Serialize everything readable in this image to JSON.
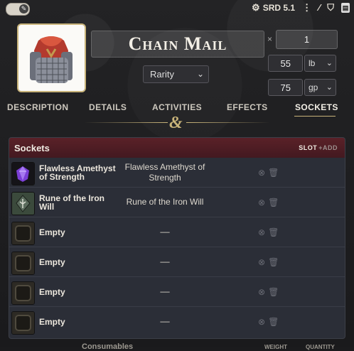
{
  "topbar": {
    "toggle_icon": "wrench-icon",
    "srd_label": "SRD 5.1",
    "icons": [
      "gear-icon",
      "kebab-menu-icon",
      "magic-wand-icon",
      "shield-icon",
      "document-icon"
    ]
  },
  "item": {
    "name": "Chain Mail",
    "rarity_placeholder": "Rarity",
    "quantity_symbol": "×",
    "quantity": "1",
    "weight_value": "55",
    "weight_unit": "lb",
    "price_value": "75",
    "price_unit": "gp"
  },
  "tabs": [
    {
      "label": "DESCRIPTION"
    },
    {
      "label": "DETAILS"
    },
    {
      "label": "ACTIVITIES"
    },
    {
      "label": "EFFECTS"
    },
    {
      "label": "SOCKETS"
    }
  ],
  "divider_glyph": "&",
  "sockets": {
    "title": "Sockets",
    "slot_label": "SLOT",
    "add_label": "+ADD",
    "rows": [
      {
        "name": "Flawless Amethyst of Strength",
        "description": "Flawless Amethyst of Strength",
        "icon": "amethyst-gem-icon"
      },
      {
        "name": "Rune of the Iron Will",
        "description": "Rune of the Iron Will",
        "icon": "rune-icon"
      },
      {
        "name": "Empty",
        "description": "––",
        "icon": "empty-slot-icon"
      },
      {
        "name": "Empty",
        "description": "––",
        "icon": "empty-slot-icon"
      },
      {
        "name": "Empty",
        "description": "––",
        "icon": "empty-slot-icon"
      },
      {
        "name": "Empty",
        "description": "––",
        "icon": "empty-slot-icon"
      }
    ]
  },
  "footer_peek": {
    "section": "Consumables",
    "weight_header": "WEIGHT",
    "quantity_header": "QUANTITY"
  },
  "colors": {
    "accent_gold": "#c9b47a",
    "header_red": "#5a2128",
    "panel_bg": "#2b2e37",
    "amethyst": "#7b3fd6"
  }
}
